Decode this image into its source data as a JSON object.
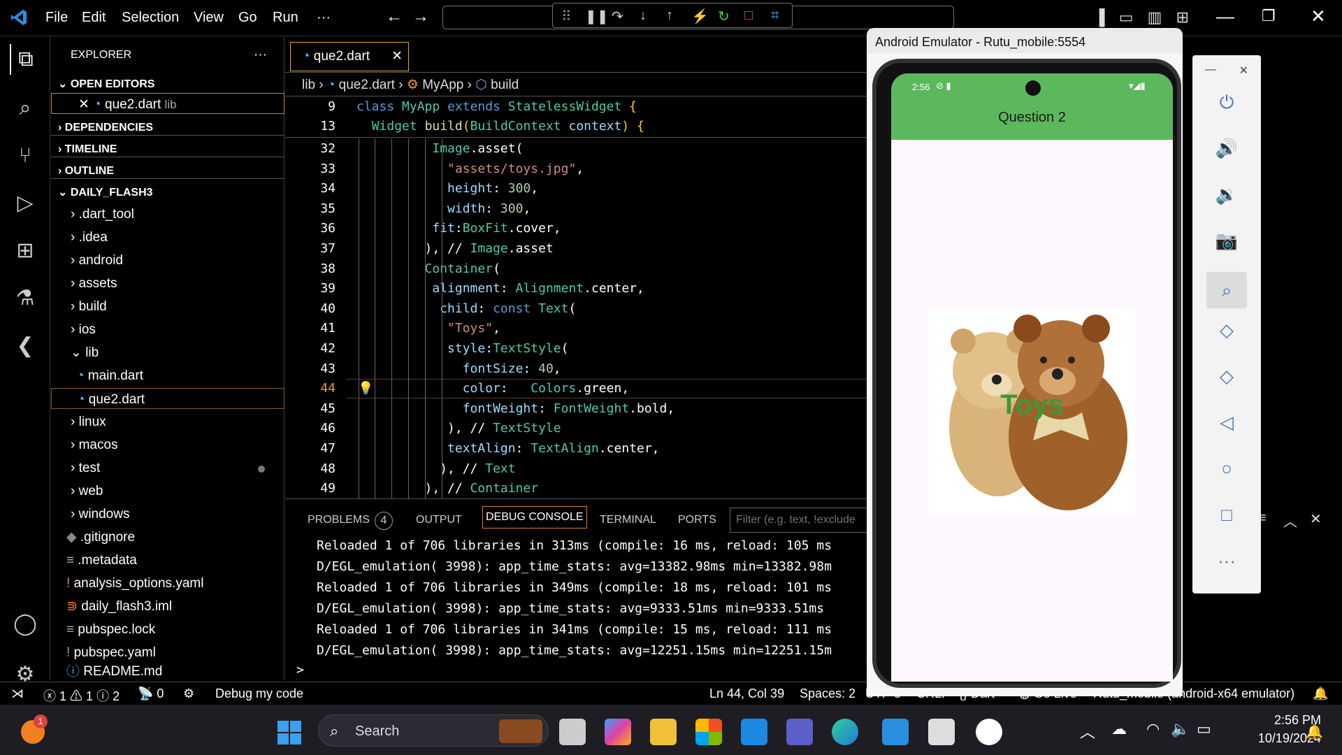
{
  "menu": {
    "file": "File",
    "edit": "Edit",
    "selection": "Selection",
    "view": "View",
    "go": "Go",
    "run": "Run",
    "more": "···"
  },
  "explorer": {
    "title": "EXPLORER",
    "more": "···",
    "open_editors": "OPEN EDITORS",
    "open_file": "que2.dart",
    "open_file_dir": "lib",
    "dependencies": "DEPENDENCIES",
    "timeline": "TIMELINE",
    "outline": "OUTLINE",
    "project": "DAILY_FLASH3",
    "items": [
      ".dart_tool",
      ".idea",
      "android",
      "assets",
      "build",
      "ios",
      "lib",
      "main.dart",
      "que2.dart",
      "linux",
      "macos",
      "test",
      "web",
      "windows",
      ".gitignore",
      ".metadata",
      "analysis_options.yaml",
      "daily_flash3.iml",
      "pubspec.lock",
      "pubspec.yaml",
      "README.md"
    ]
  },
  "editor": {
    "tab": "que2.dart",
    "breadcrumb": {
      "a": "lib",
      "b": "que2.dart",
      "c": "MyApp",
      "d": "build"
    },
    "sticky": [
      {
        "n": "9",
        "t": "class MyApp extends StatelessWidget {"
      },
      {
        "n": "13",
        "t": "  Widget build(BuildContext context) {"
      }
    ],
    "lines": [
      {
        "n": "32",
        "t": "          Image.asset("
      },
      {
        "n": "33",
        "t": "            \"assets/toys.jpg\","
      },
      {
        "n": "34",
        "t": "            height: 300,"
      },
      {
        "n": "35",
        "t": "            width: 300,"
      },
      {
        "n": "36",
        "t": "          fit:BoxFit.cover,"
      },
      {
        "n": "37",
        "t": "         ), // Image.asset"
      },
      {
        "n": "38",
        "t": "         Container("
      },
      {
        "n": "39",
        "t": "          alignment: Alignment.center,"
      },
      {
        "n": "40",
        "t": "           child: const Text("
      },
      {
        "n": "41",
        "t": "            \"Toys\","
      },
      {
        "n": "42",
        "t": "            style:TextStyle("
      },
      {
        "n": "43",
        "t": "              fontSize: 40,"
      },
      {
        "n": "44",
        "t": "              color:   Colors.green,"
      },
      {
        "n": "45",
        "t": "              fontWeight: FontWeight.bold,"
      },
      {
        "n": "46",
        "t": "            ), // TextStyle"
      },
      {
        "n": "47",
        "t": "            textAlign: TextAlign.center,"
      },
      {
        "n": "48",
        "t": "           ), // Text"
      },
      {
        "n": "49",
        "t": "         ), // Container"
      }
    ]
  },
  "panel": {
    "problems": "PROBLEMS",
    "problems_count": "4",
    "output": "OUTPUT",
    "debug_console": "DEBUG CONSOLE",
    "terminal": "TERMINAL",
    "ports": "PORTS",
    "filter_placeholder": "Filter (e.g. text, !exclude",
    "console": [
      "Reloaded 1 of 706 libraries in 313ms (compile: 16 ms, reload: 105 ms",
      "D/EGL_emulation( 3998): app_time_stats: avg=13382.98ms min=13382.98m",
      "Reloaded 1 of 706 libraries in 349ms (compile: 18 ms, reload: 101 ms",
      "D/EGL_emulation( 3998): app_time_stats: avg=9333.51ms min=9333.51ms",
      "Reloaded 1 of 706 libraries in 341ms (compile: 15 ms, reload: 111 ms",
      "D/EGL_emulation( 3998): app_time_stats: avg=12251.15ms min=12251.15m"
    ],
    "prompt": ">"
  },
  "status": {
    "errors": "1",
    "warnings": "1",
    "info": "2",
    "ports": "0",
    "debug": "Debug my code",
    "position": "Ln 44, Col 39",
    "spaces": "Spaces: 2",
    "encoding": "UTF-8",
    "eol": "CRLF",
    "language": "Dart",
    "golive": "Go Live",
    "device": "Rutu_mobile (android-x64 emulator)"
  },
  "emulator": {
    "title": "Android Emulator - Rutu_mobile:5554",
    "time": "2:56",
    "app_title": "Question 2",
    "overlay_text": "Toys",
    "toys_color": "#3a9a3a"
  },
  "taskbar": {
    "search": "Search",
    "time": "2:56 PM",
    "date": "10/19/2024",
    "notif": "1"
  }
}
